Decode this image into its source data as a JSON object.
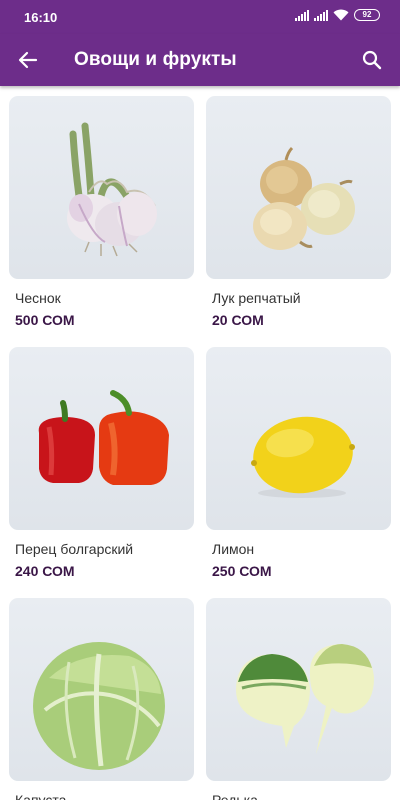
{
  "status_bar": {
    "time": "16:10",
    "battery": "92",
    "icons": [
      "signal-icon",
      "signal-icon",
      "wifi-icon",
      "battery-icon"
    ]
  },
  "app_bar": {
    "title": "Овощи и фрукты",
    "back_icon": "arrow-left-icon",
    "search_icon": "search-icon",
    "background": "#6d2d8a"
  },
  "products": [
    {
      "name": "Чеснок",
      "price": "500 СОМ",
      "image": "garlic"
    },
    {
      "name": "Лук репчатый",
      "price": "20 СОМ",
      "image": "onion"
    },
    {
      "name": "Перец болгарский",
      "price": "240 СОМ",
      "image": "bell-pepper"
    },
    {
      "name": "Лимон",
      "price": "250 СОМ",
      "image": "lemon"
    },
    {
      "name": "Капуста",
      "price": "",
      "image": "cabbage"
    },
    {
      "name": "Редька",
      "price": "",
      "image": "radish"
    }
  ]
}
